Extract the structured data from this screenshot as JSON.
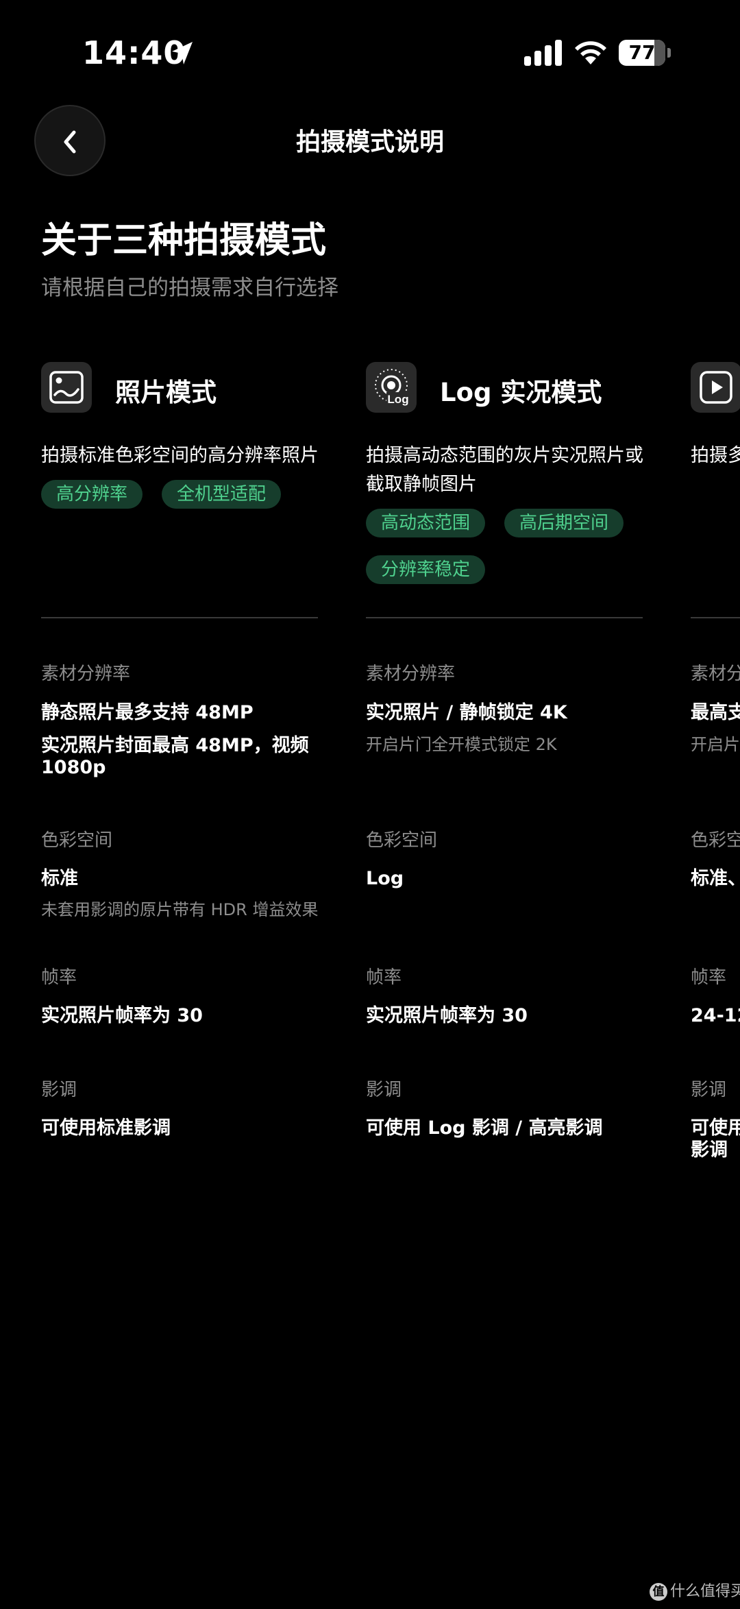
{
  "status_bar": {
    "time": "14:40",
    "battery": "77"
  },
  "nav": {
    "title": "拍摄模式说明"
  },
  "header": {
    "title": "关于三种拍摄模式",
    "subtitle": "请根据自己的拍摄需求自行选择"
  },
  "accent_color": "#4fd18e",
  "modes": [
    {
      "icon": "photo-icon",
      "title": "照片模式",
      "description": [
        "拍摄标准色彩空间的高分辨率照片"
      ],
      "tags": [
        "高分辨率",
        "全机型适配"
      ],
      "sections": [
        {
          "label": "素材分辨率",
          "values": [
            "静态照片最多支持 48MP",
            "实况照片封面最高 48MP，视频",
            "1080p"
          ],
          "note": ""
        },
        {
          "label": "色彩空间",
          "values": [
            "标准"
          ],
          "note": "未套用影调的原片带有 HDR 增益效果"
        },
        {
          "label": "帧率",
          "values": [
            "实况照片帧率为 30"
          ],
          "note": ""
        },
        {
          "label": "影调",
          "values": [
            "可使用标准影调"
          ],
          "note": ""
        }
      ]
    },
    {
      "icon": "log-live-icon",
      "icon_text": "Log",
      "title": "Log 实况模式",
      "description": [
        "拍摄高动态范围的灰片实况照片或",
        "截取静帧图片"
      ],
      "tags": [
        "高动态范围",
        "高后期空间",
        "分辨率稳定"
      ],
      "sections": [
        {
          "label": "素材分辨率",
          "values": [
            "实况照片 / 静帧锁定 4K"
          ],
          "note": "开启片门全开模式锁定 2K"
        },
        {
          "label": "色彩空间",
          "values": [
            "Log"
          ],
          "note": ""
        },
        {
          "label": "帧率",
          "values": [
            "实况照片帧率为 30"
          ],
          "note": ""
        },
        {
          "label": "影调",
          "values": [
            "可使用 Log 影调 / 高亮影调"
          ],
          "note": ""
        }
      ]
    },
    {
      "icon": "play-icon",
      "title": "",
      "description": [
        "拍摄多"
      ],
      "tags": [],
      "sections": [
        {
          "label": "素材分",
          "values": [
            "最高支"
          ],
          "note": "开启片"
        },
        {
          "label": "色彩空",
          "values": [
            "标准、"
          ],
          "note": ""
        },
        {
          "label": "帧率",
          "values": [
            "24-12"
          ],
          "note": ""
        },
        {
          "label": "影调",
          "values": [
            "可使用",
            "影调"
          ],
          "note": ""
        }
      ]
    }
  ],
  "watermark": {
    "text": "什么值得买",
    "logo": "值"
  }
}
